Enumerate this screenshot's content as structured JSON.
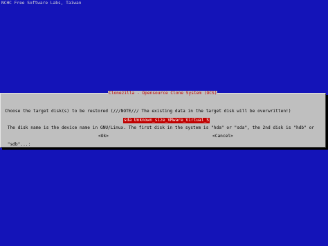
{
  "header": {
    "text": "NCHC Free Software Labs, Taiwan"
  },
  "dialog": {
    "title": "Clonezilla - Opensource Clone System (OCS)",
    "message_lines": [
      "Choose the target disk(s) to be restored (///NOTE/// The existing data in the target disk will be overwritten!)",
      " The disk name is the device name in GNU/Linux. The first disk in the system is \"hda\" or \"sda\", the 2nd disk is \"hdb\" or",
      " \"sdb\"...:"
    ],
    "menu_items": [
      {
        "label": "sda Unknown_size_VMware_Virtual_S",
        "selected": true
      }
    ],
    "buttons": {
      "ok": "<Ok>",
      "cancel": "<Cancel>"
    }
  },
  "colors": {
    "background": "#1414b8",
    "dialog": "#bfbfbf",
    "title": "#c00000",
    "highlight": "#c00000",
    "shadow": "#000000"
  }
}
